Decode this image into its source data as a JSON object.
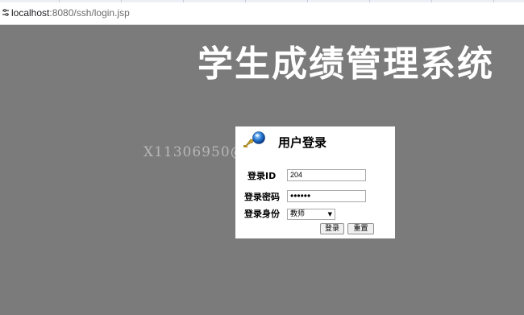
{
  "browser": {
    "address_host": "localhost",
    "address_rest": ":8080/ssh/login.jsp",
    "site_info_icon": "site-settings-icon"
  },
  "page": {
    "title": "学生成绩管理系统",
    "background": "#7b7b7b"
  },
  "login": {
    "logo_icon": "key-globe-icon",
    "panel_title": "用户登录",
    "id_label": "登录ID",
    "id_value": "204",
    "password_label": "登录密码",
    "password_value": "••••••",
    "role_label": "登录身份",
    "role_selected": "教师",
    "submit_label": "登录",
    "reset_label": "重置"
  },
  "watermark": {
    "text": "X11306950@zuidaima.com"
  }
}
